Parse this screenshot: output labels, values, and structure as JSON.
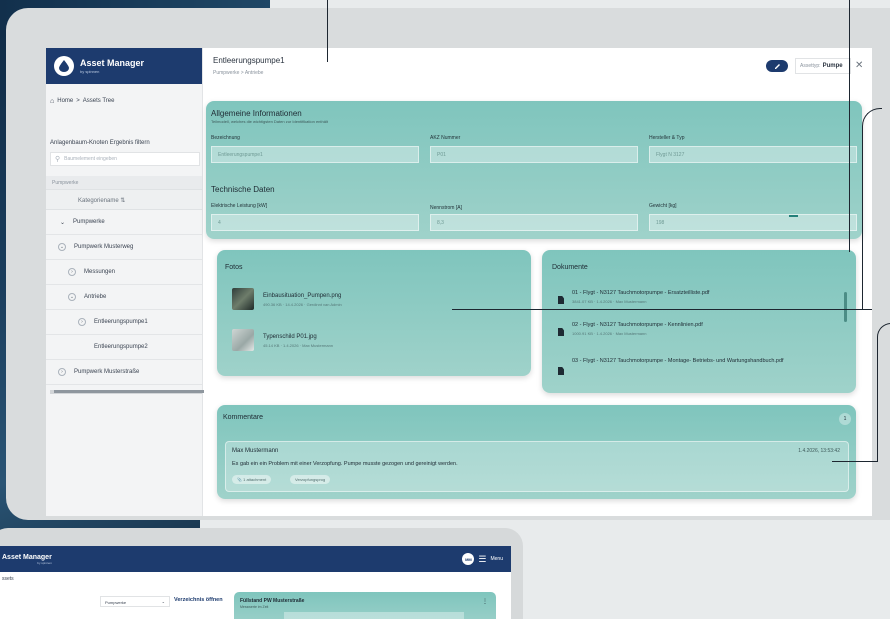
{
  "brand": {
    "name": "Asset Manager",
    "by": "by spinnen"
  },
  "breadcrumbs": [
    "Home",
    ">",
    "Assets Tree"
  ],
  "filter": {
    "label": "Anlagenbaum-Knoten Ergebnis filtern",
    "placeholder": "Baumelement eingeben"
  },
  "tree": {
    "header": "Pumpwerke",
    "column": "Kategoriename",
    "rows": [
      "Pumpwerke",
      "Pumpwerk Musterweg",
      "Messungen",
      "Antriebe",
      "Entleerungspumpe1",
      "Entleerungspumpe2",
      "Pumpwerk Musterstraße"
    ]
  },
  "header": {
    "title": "Entleerungspumpe1",
    "path": "Pumpwerke > Antriebe",
    "asset_type_label": "Assettyp:",
    "asset_type_value": "Pumpe"
  },
  "general": {
    "title": "Allgemeine Informationen",
    "subtitle": "Teilmodell, welches die wichtigsten Daten zur Identifikation enthält",
    "fields": [
      {
        "label": "Bezeichnung",
        "value": "Entleerungspumpe1"
      },
      {
        "label": "AKZ Nummer",
        "value": "P01"
      },
      {
        "label": "Hersteller & Typ",
        "value": "Flygt N 3127"
      }
    ],
    "tech_title": "Technische Daten",
    "tech_fields": [
      {
        "label": "Elektrische Leistung [kW]",
        "value": "4"
      },
      {
        "label": "Nennstrom [A]",
        "value": "8,3"
      },
      {
        "label": "Gewicht [kg]",
        "value": "198"
      }
    ]
  },
  "photos": {
    "title": "Fotos",
    "items": [
      {
        "name": "Einbausituation_Pumpen.png",
        "meta": "490.36 KB · 14.4.2026 · Gerdinnt van Admin"
      },
      {
        "name": "Typenschild P01.jpg",
        "meta": "45.14 KB · 1.4.2026 · Max Mustermann"
      }
    ]
  },
  "documents": {
    "title": "Dokumente",
    "items": [
      {
        "name": "01 - Flygt - N3127 Tauchmotorpumpe - Ersatzteilliste.pdf",
        "meta": "3841.07 KB · 1.4.2026 · Max Mustermann"
      },
      {
        "name": "02 - Flygt - N3127 Tauchmotorpumpe - Kennlinien.pdf",
        "meta": "1000.91 KB · 1.4.2026 · Max Mustermann"
      },
      {
        "name": "03 - Flygt - N3127 Tauchmotorpumpe - Montage- Betriebs- und Wartungshandbuch.pdf",
        "meta": ""
      }
    ]
  },
  "comments": {
    "title": "Kommentare",
    "count": "1",
    "author": "Max Mustermann",
    "timestamp": "1.4.2026, 13:53:42",
    "text": "Es gab ein ein Problem mit einer Verzopfung. Pumpe musste gezogen und gereinigt werden.",
    "chips": [
      "1 attachment",
      "Verzopfungsprog"
    ]
  },
  "second_screen": {
    "brand": "Asset Manager",
    "brand_by": "by spinnen",
    "avatar": "MM",
    "menu": "Menu",
    "assets_label": "ssets",
    "select_value": "Pumpwerke",
    "open_link": "Verzeichnis öffnen",
    "panel_title": "Füllstand PW Musterstraße",
    "panel_sub": "Messwerte im Zeit"
  },
  "colors": {
    "brand_navy": "#1d3b6e",
    "teal_panel": "#8ccbc3"
  }
}
